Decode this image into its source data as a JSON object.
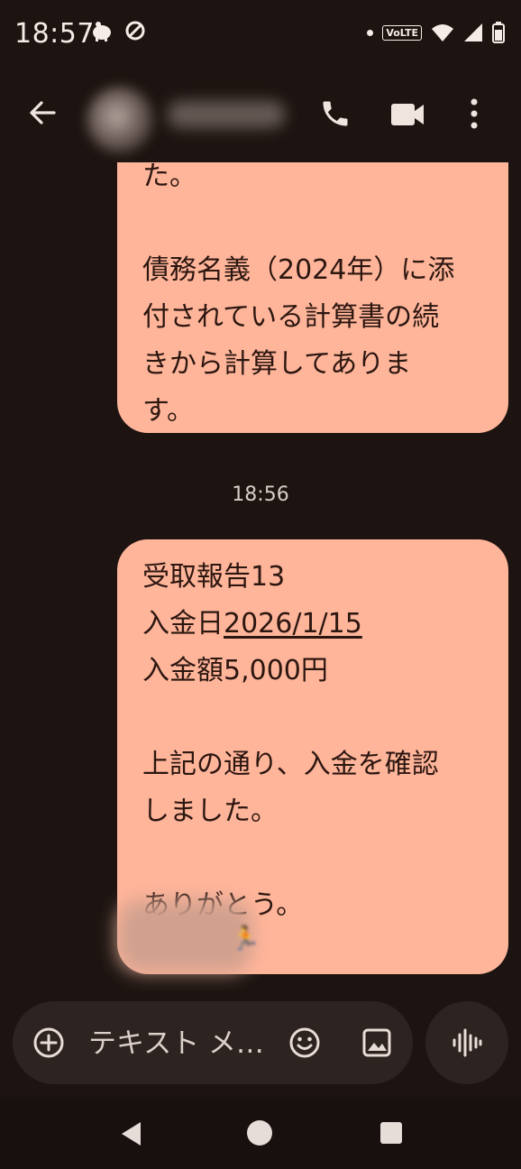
{
  "status_bar": {
    "time": "18:57",
    "icons": [
      "piggy-bank-icon",
      "do-not-disturb-icon",
      "notification-dot-icon",
      "volte-icon",
      "wifi-icon",
      "signal-icon",
      "battery-icon"
    ],
    "volte_label": "VoLTE"
  },
  "app_bar": {
    "contact_name": "",
    "icons": [
      "back-arrow-icon",
      "avatar",
      "phone-icon",
      "video-camera-icon",
      "more-vert-icon"
    ]
  },
  "conversation": {
    "message1": {
      "lines": [
        "た。",
        "",
        "債務名義（2024年）に添",
        "付されている計算書の続",
        "きから計算してありま",
        "す。"
      ]
    },
    "timestamp": "18:56",
    "message2": {
      "line1": "受取報告13",
      "line2_prefix": "入金日",
      "line2_date": "2026/1/15",
      "line3": "入金額5,000円",
      "line4": "",
      "line5": "上記の通り、入金を確認",
      "line6": "しました。",
      "line7": "",
      "line8": "ありがとう。"
    }
  },
  "composer": {
    "placeholder": "テキスト メ…",
    "icons": [
      "add-circle-icon",
      "emoji-icon",
      "image-icon",
      "voice-waveform-icon"
    ]
  },
  "nav_bar": {
    "icons": [
      "nav-back-icon",
      "nav-home-icon",
      "nav-recents-icon"
    ]
  },
  "colors": {
    "background": "#1d1411",
    "bubble": "#ffb59a",
    "bubble_text": "#2b1610",
    "composer": "#2d2320"
  }
}
